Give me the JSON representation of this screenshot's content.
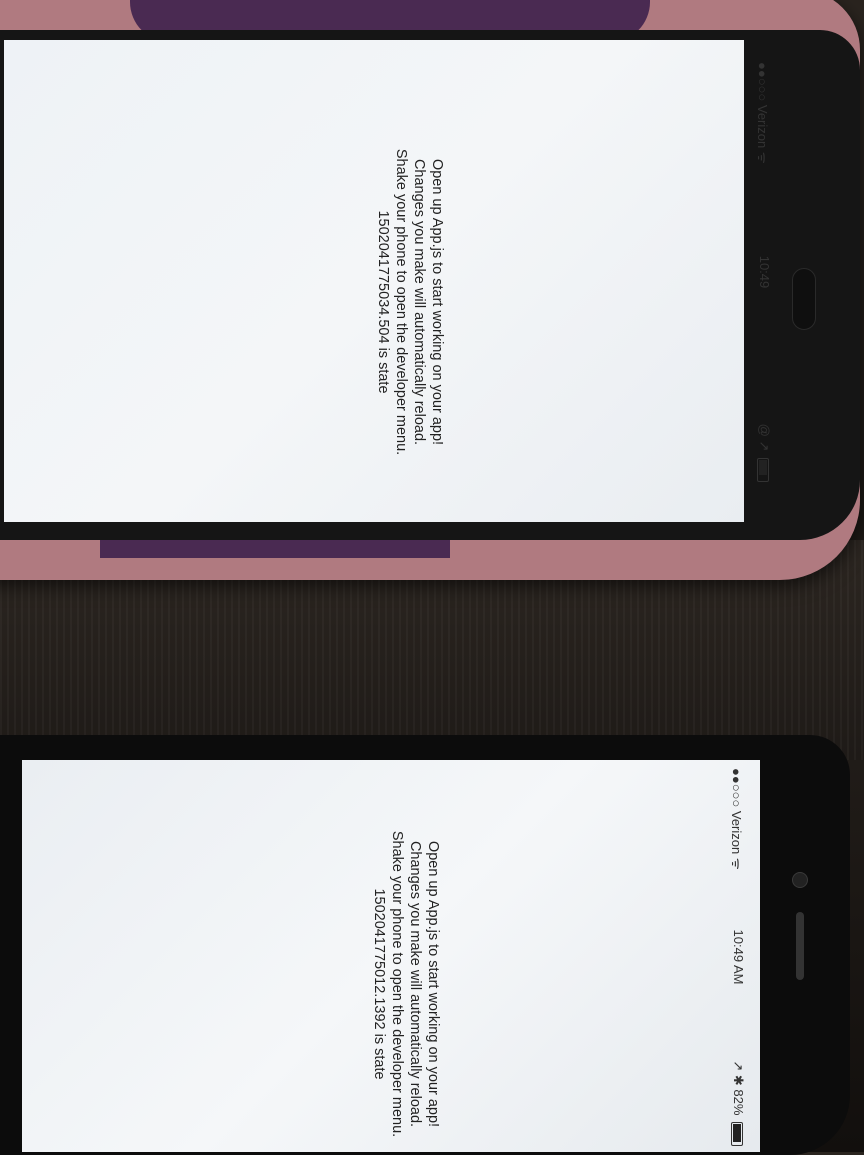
{
  "top_phone": {
    "status": {
      "carrier": "●●○○○ Verizon ᯤ",
      "time": "10:49",
      "right": "@ ↗"
    },
    "lines": [
      "Open up App.js to start working on your app!",
      "Changes you make will automatically reload.",
      "Shake your phone to open the developer menu.",
      "1502041775034.504 is state"
    ]
  },
  "bottom_phone": {
    "status": {
      "carrier": "●●○○○ Verizon ᯤ",
      "time": "10:49 AM",
      "right": "↗ ✱ 82%"
    },
    "battery_level": 0.82,
    "lines": [
      "Open up App.js to start working on your app!",
      "Changes you make will automatically reload.",
      "Shake your phone to open the developer menu.",
      "1502041775012.1392 is state"
    ]
  }
}
